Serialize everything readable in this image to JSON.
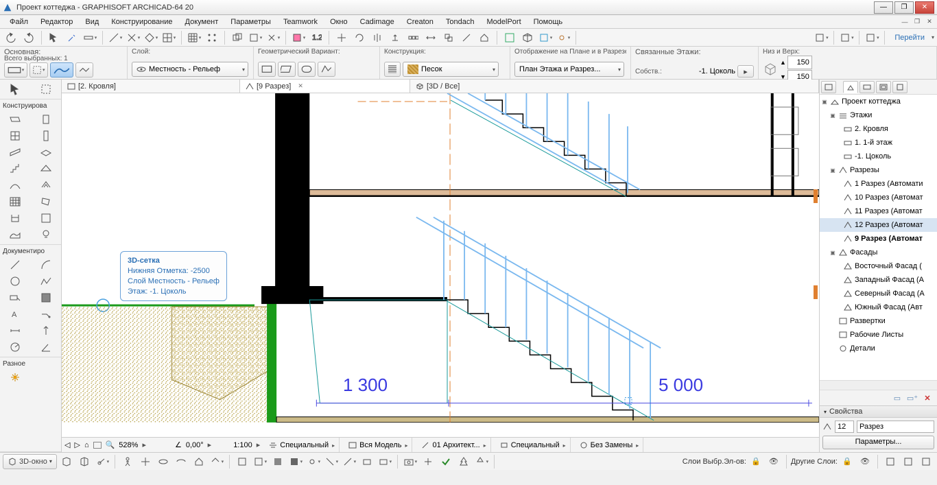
{
  "app": {
    "title": "Проект коттеджа - GRAPHISOFT ARCHICAD-64 20"
  },
  "menu": [
    "Файл",
    "Редактор",
    "Вид",
    "Конструирование",
    "Документ",
    "Параметры",
    "Teamwork",
    "Окно",
    "Cadimage",
    "Creaton",
    "Tondach",
    "ModelPort",
    "Помощь"
  ],
  "goto_label": "Перейти",
  "propbar": {
    "main_label": "Основная:",
    "selected_label": "Всего выбранных: 1",
    "layer_label": "Слой:",
    "layer_value": "Местность - Рельеф",
    "geom_label": "Геометрический Вариант:",
    "constr_label": "Конструкция:",
    "constr_value": "Песок",
    "plan_label": "Отображение на Плане и в Разрезе:",
    "plan_value": "План Этажа и Разрез...",
    "floors_label": "Связанные Этажи:",
    "floors_sub": "Собств.:",
    "floors_value": "-1. Цоколь",
    "nv_label": "Низ и Верх:",
    "nv_val1": "150",
    "nv_val2": "150"
  },
  "doctabs": [
    {
      "label": "[2. Кровля]"
    },
    {
      "label": "[9 Разрез]",
      "active": true,
      "closeable": true
    },
    {
      "label": "[3D / Все]"
    }
  ],
  "toolbox": {
    "section_design": "Конструирова",
    "section_doc": "Документиро",
    "section_misc": "Разное"
  },
  "infobox": {
    "line1": "3D-сетка",
    "line2": "Нижняя Отметка: -2500",
    "line3": "Слой Местность - Рельеф",
    "line4": "Этаж: -1. Цоколь"
  },
  "dims": {
    "d1": "1 300",
    "d2": "5 000"
  },
  "zoomrow": {
    "zoom_pct": "528%",
    "angle": "0,00°",
    "scale": "1:100",
    "mvo1": "Специальный",
    "mvo2": "Вся Модель",
    "mvo3": "01 Архитект...",
    "mvo4": "Специальный",
    "mvo5": "Без Замены"
  },
  "navigator": {
    "root": "Проект коттеджа",
    "etazhi": "Этажи",
    "etazhi_items": [
      "2. Кровля",
      "1. 1-й этаж",
      "-1. Цоколь"
    ],
    "razrezy": "Разрезы",
    "razrezy_items": [
      "1 Разрез (Автомати",
      "10 Разрез (Автомат",
      "11 Разрез (Автомат",
      "12 Разрез (Автомат",
      "9 Разрез (Автомат"
    ],
    "fasady": "Фасады",
    "fasady_items": [
      "Восточный Фасад (",
      "Западный Фасад (А",
      "Северный Фасад (А",
      "Южный Фасад (Авт"
    ],
    "razvertki": "Развертки",
    "rabochie": "Рабочие Листы",
    "detali": "Детали"
  },
  "props_panel": {
    "title": "Свойства",
    "id_value": "12",
    "name_value": "Разрез",
    "params_btn": "Параметры..."
  },
  "appbar": {
    "win3d": "3D-окно",
    "layers1": "Слои Выбр.Эл-ов:",
    "layers2": "Другие Слои:"
  }
}
